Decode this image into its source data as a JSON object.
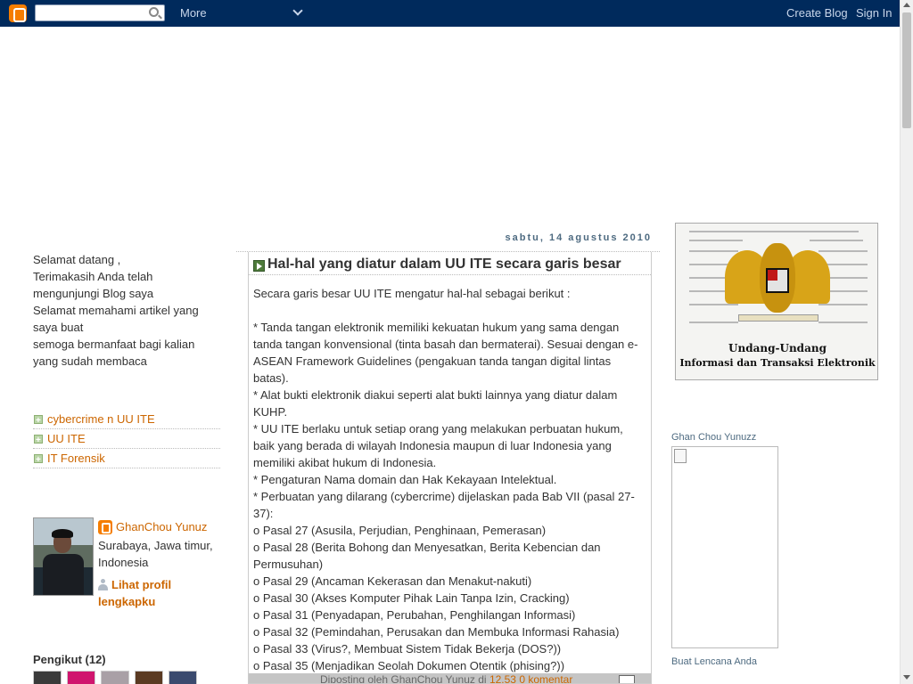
{
  "navbar": {
    "search_placeholder": "",
    "more_label": "More",
    "create_blog_label": "Create Blog",
    "sign_in_label": "Sign In"
  },
  "sidebar_left": {
    "welcome_lines": [
      "Selamat datang ,",
      "Terimakasih Anda telah",
      "mengunjungi Blog saya",
      "Selamat memahami artikel yang",
      "saya buat",
      "semoga bermanfaat bagi kalian",
      "yang sudah membaca"
    ],
    "labels": [
      "cybercrime n UU ITE",
      "UU ITE",
      "IT Forensik"
    ],
    "profile": {
      "name": "GhanChou Yunuz",
      "location": "Surabaya, Jawa timur, Indonesia",
      "full_profile_link": "Lihat profil lengkapku"
    },
    "followers_title": "Pengikut (12)"
  },
  "post": {
    "date": "sabtu, 14 agustus 2010",
    "title": "Hal-hal yang diatur dalam UU ITE secara garis besar",
    "body_lines": [
      "Secara garis besar UU ITE mengatur hal-hal sebagai berikut :",
      "",
      "* Tanda tangan elektronik memiliki kekuatan hukum yang sama dengan",
      "tanda tangan konvensional (tinta basah dan bermaterai). Sesuai dengan e-",
      "ASEAN Framework Guidelines (pengakuan tanda tangan digital lintas",
      "batas).",
      "* Alat bukti elektronik diakui seperti alat bukti lainnya yang diatur dalam",
      "KUHP.",
      "* UU ITE berlaku untuk setiap orang yang melakukan perbuatan hukum,",
      "baik yang berada di wilayah Indonesia maupun di luar Indonesia yang",
      "memiliki akibat hukum di Indonesia.",
      "* Pengaturan Nama domain dan Hak Kekayaan Intelektual.",
      "* Perbuatan yang dilarang (cybercrime) dijelaskan pada Bab VII (pasal 27-",
      "37):",
      "o Pasal 27 (Asusila, Perjudian, Penghinaan, Pemerasan)",
      "o Pasal 28 (Berita Bohong dan Menyesatkan, Berita Kebencian dan",
      "Permusuhan)",
      "o Pasal 29 (Ancaman Kekerasan dan Menakut-nakuti)",
      "o Pasal 30 (Akses Komputer Pihak Lain Tanpa Izin, Cracking)",
      "o Pasal 31 (Penyadapan, Perubahan, Penghilangan Informasi)",
      "o Pasal 32 (Pemindahan, Perusakan dan Membuka Informasi Rahasia)",
      "o Pasal 33 (Virus?, Membuat Sistem Tidak Bekerja (DOS?))",
      "o Pasal 35 (Menjadikan Seolah Dokumen Otentik (phising?))"
    ],
    "footer": {
      "posted_by": "Diposting oleh GhanChou Yunuz di",
      "time": "12.53",
      "comments": "0 komentar"
    }
  },
  "sidebar_right": {
    "image_caption_line1": "Undang-Undang",
    "image_caption_line2": "Informasi dan Transaksi Elektronik",
    "badge_title": "Ghan Chou Yunuzz",
    "badge_link": "Buat Lencana Anda"
  },
  "colors": {
    "navbar_bg": "#002a5c",
    "link": "#cc6600",
    "blogger_orange": "#f57d00",
    "date_header": "#4d6a80"
  }
}
